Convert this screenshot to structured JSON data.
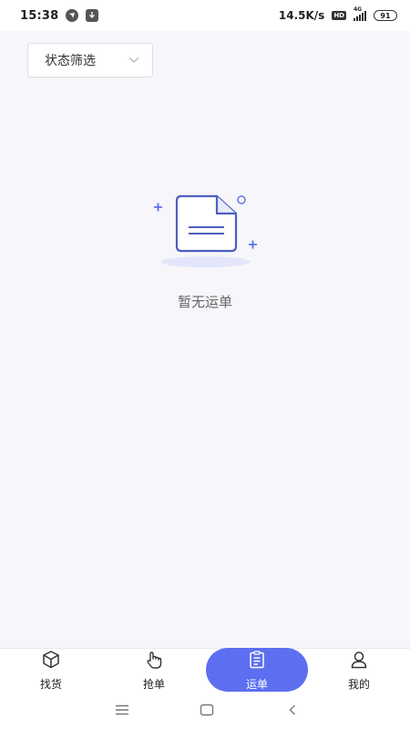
{
  "status_bar": {
    "time": "15:38",
    "net_speed": "14.5K/s",
    "hd_label": "HD",
    "network_type": "4G",
    "battery": "91",
    "icons": [
      "app-notification-icon",
      "download-icon",
      "hd-icon",
      "signal-icon",
      "battery-icon"
    ]
  },
  "filter": {
    "label": "状态筛选"
  },
  "empty_state": {
    "icon": "empty-document-icon",
    "text": "暂无运单",
    "accent_color": "#5c6ff0"
  },
  "tab_bar": {
    "active_color": "#5c6ff0",
    "tabs": [
      {
        "label": "找货",
        "icon": "box-icon"
      },
      {
        "label": "抢单",
        "icon": "tap-hand-icon"
      },
      {
        "label": "运单",
        "icon": "clipboard-icon",
        "active": true
      },
      {
        "label": "我的",
        "icon": "user-icon"
      }
    ]
  },
  "system_nav": {
    "icons": [
      "menu-icon",
      "home-icon",
      "back-icon"
    ]
  }
}
